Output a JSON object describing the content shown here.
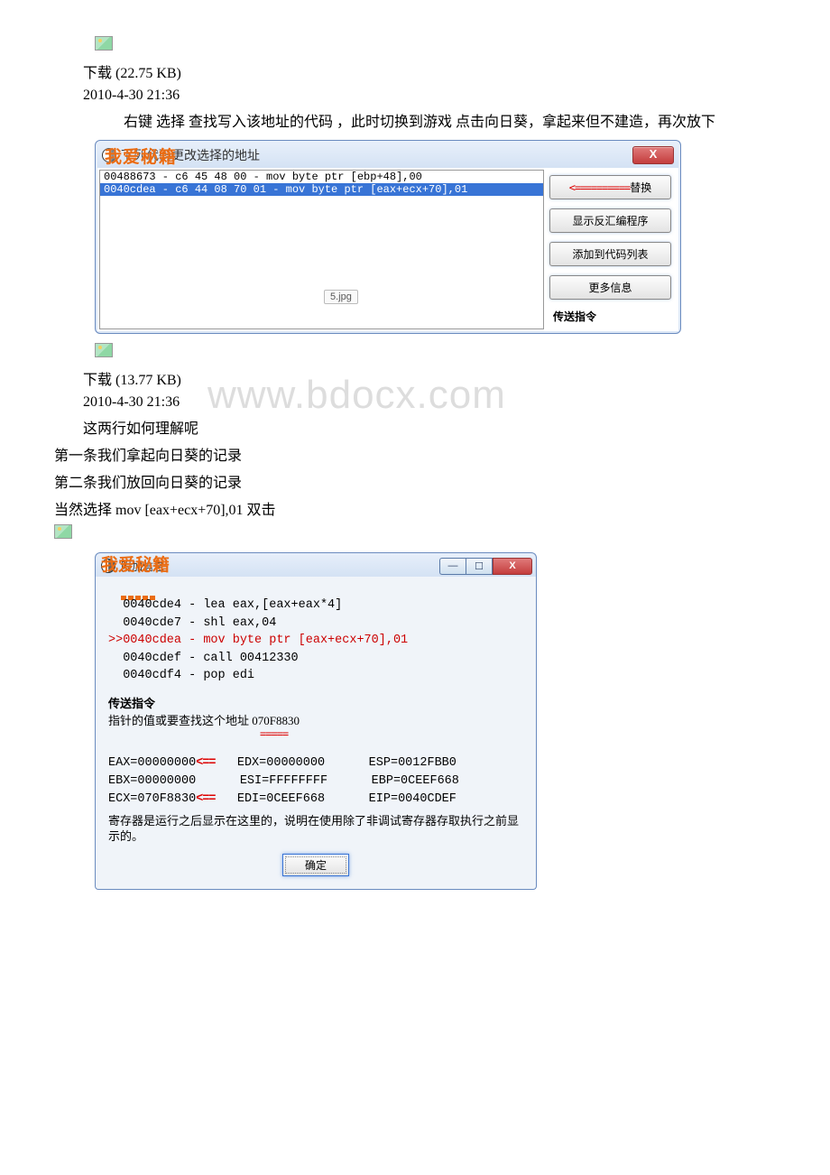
{
  "placeholder1_alt": "image",
  "download1": "下载 (22.75 KB)",
  "timestamp1": "2010-4-30 21:36",
  "para1": "右键 选择 查找写入该地址的代码 ，此时切换到游戏 点击向日葵，拿起来但不建造，再次放下",
  "win1": {
    "overlay": "我爱秘籍",
    "title": "下列代码更改选择的地址",
    "code1": "00488673 - c6 45 48 00 - mov byte ptr [ebp+48],00",
    "code2": "0040cdea - c6 44 08 70 01 - mov byte ptr [eax+ecx+70],01",
    "annot_arrow": "<==",
    "annot_eq": "====",
    "btn_replace": "替换",
    "btn_disasm": "显示反汇编程序",
    "btn_addcode": "添加到代码列表",
    "btn_more": "更多信息",
    "lbl_send": "传送指令",
    "tag": "5.jpg",
    "close": "X"
  },
  "download2": "下载 (13.77 KB)",
  "timestamp2": "2010-4-30 21:36",
  "watermark": "www.bdocx.com",
  "para2a": "这两行如何理解呢",
  "para2b": "第一条我们拿起向日葵的记录",
  "para2c": "第二条我们放回向日葵的记录",
  "para2d": "当然选择 mov [eax+ecx+70],01 双击",
  "win2": {
    "overlay": "我爱秘籍",
    "title": "附加信息",
    "asm1": "  0040cde4 - lea eax,[eax+eax*4]",
    "asm2": "  0040cde7 - shl eax,04",
    "asm3": ">>0040cdea - mov byte ptr [eax+ecx+70],01",
    "asm4": "  0040cdef - call 00412330",
    "asm5": "  0040cdf4 - pop edi",
    "send": "传送指令",
    "pointer": "指针的值或要查找这个地址 070F8830",
    "red_ul": "=====",
    "reg_eax": "EAX=00000000",
    "reg_edx": "EDX=00000000",
    "reg_esp": "ESP=0012FBB0",
    "reg_ebx": "EBX=00000000",
    "reg_esi": "ESI=FFFFFFFF",
    "reg_ebp": "EBP=0CEEF668",
    "reg_ecx": "ECX=070F8830",
    "reg_edi": "EDI=0CEEF668",
    "reg_eip": "EIP=0040CDEF",
    "arr": "<==",
    "note": "寄存器是运行之后显示在这里的，说明在使用除了非调试寄存器存取执行之前显示的。",
    "ok": "确定",
    "min": "—",
    "max": "☐",
    "close": "X"
  }
}
